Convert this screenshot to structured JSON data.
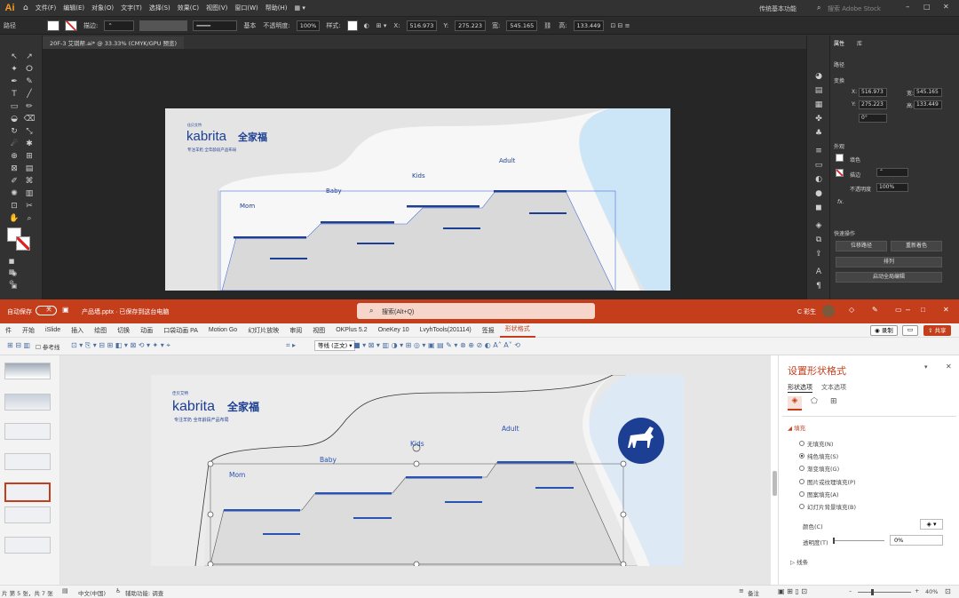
{
  "ai": {
    "logo": "Ai",
    "menus": [
      "文件(F)",
      "编辑(E)",
      "对象(O)",
      "文字(T)",
      "选择(S)",
      "效果(C)",
      "视图(V)",
      "窗口(W)",
      "帮助(H)"
    ],
    "workspace": "传统基本功能",
    "search_placeholder": "搜索 Adobe Stock",
    "control": {
      "selection": "路径",
      "stroke_label": "描边:",
      "stroke_style": "基本",
      "opacity_label": "不透明度:",
      "opacity": "100%",
      "style_label": "样式:",
      "x_label": "X:",
      "x": "516.973",
      "y_label": "Y:",
      "y": "275.223",
      "w_label": "宽:",
      "w": "545.165",
      "h_label": "高:",
      "h": "133.449"
    },
    "doc_tab": "20F-3 艾琪帮.ai* @ 33.33% (CMYK/GPU 预览)",
    "props": {
      "tabs": [
        "属性",
        "库"
      ],
      "section_path": "路径",
      "transform": "变换",
      "x_label": "X:",
      "x": "516.973",
      "y_label": "Y:",
      "y": "275.223",
      "w_label": "宽:",
      "w": "545.165",
      "h_label": "高:",
      "h": "133.449",
      "angle": "0°",
      "appearance": "外观",
      "fill_label": "填色",
      "stroke_label": "描边",
      "opacity_label": "不透明度",
      "opacity": "100%",
      "fx": "fx.",
      "quick_actions": "快速操作",
      "btn_offset": "位移路径",
      "btn_recolor": "重新着色",
      "btn_arrange": "排列",
      "btn_global_edit": "启动全局编辑"
    }
  },
  "artwork": {
    "brand_small": "佳贝艾特",
    "brand": "kabrita",
    "brand_cn": "全家福",
    "tagline": "专注羊奶  全年龄段产品布局",
    "labels": {
      "mom": "Mom",
      "baby": "Baby",
      "kids": "Kids",
      "adult": "Adult"
    },
    "colors": {
      "blue": "#1c3f94",
      "gray": "#e4e4e4",
      "light_blue": "#cde6f7"
    }
  },
  "pp": {
    "autosave": "自动保存",
    "autosave_state": "关",
    "filename": "产品墙.pptx · 已保存到这台电脑",
    "search_placeholder": "搜索(Alt+Q)",
    "user": "C 彩生",
    "tabs": [
      "件",
      "开始",
      "iSlide",
      "插入",
      "绘图",
      "切换",
      "动画",
      "口袋动画 PA",
      "Motion Go",
      "幻灯片放映",
      "审阅",
      "视图",
      "OKPlus 5.2",
      "OneKey 10",
      "LvyhTools(201114)",
      "签报",
      "形状格式"
    ],
    "active_tab": "形状格式",
    "record": "录制",
    "share": "共享",
    "qa_ref": "参考线",
    "qa_font": "等线 (正文)",
    "pane": {
      "title": "设置形状格式",
      "tab_shape": "形状选项",
      "tab_text": "文本选项",
      "fill_section": "填充",
      "options": [
        "无填充(N)",
        "纯色填充(S)",
        "渐变填充(G)",
        "图片或纹理填充(P)",
        "图案填充(A)",
        "幻灯片背景填充(B)"
      ],
      "selected_option": 1,
      "color_label": "颜色(C)",
      "transparency_label": "透明度(T)",
      "transparency": "0%",
      "line_section": "线条"
    },
    "status": {
      "slide": "片 第 5 张，共 7 张",
      "lang": "中文(中国)",
      "accessibility": "辅助功能: 调查",
      "notes": "备注",
      "zoom": "40%"
    }
  }
}
